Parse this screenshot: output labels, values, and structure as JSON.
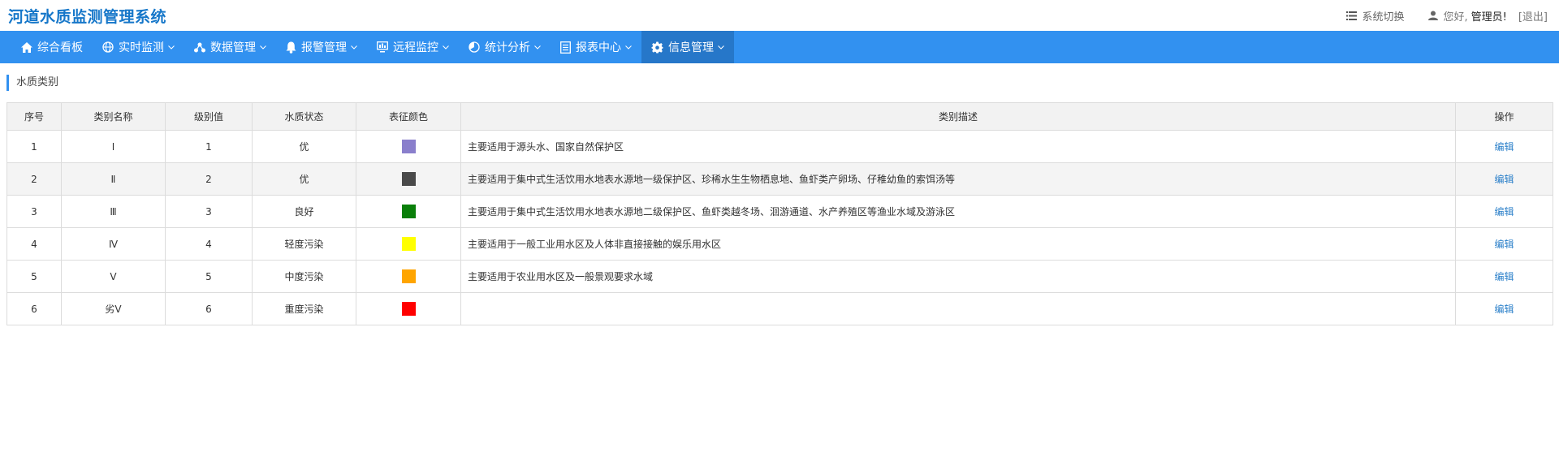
{
  "app": {
    "title": "河道水质监测管理系统"
  },
  "header": {
    "system_switch_label": "系统切换",
    "greeting": "您好,",
    "user": "管理员!",
    "logout_label": "[退出]"
  },
  "nav": {
    "items": [
      {
        "label": "综合看板",
        "icon": "home-icon",
        "dropdown": false
      },
      {
        "label": "实时监测",
        "icon": "globe-icon",
        "dropdown": true
      },
      {
        "label": "数据管理",
        "icon": "nodes-icon",
        "dropdown": true
      },
      {
        "label": "报警管理",
        "icon": "bell-icon",
        "dropdown": true
      },
      {
        "label": "远程监控",
        "icon": "monitor-icon",
        "dropdown": true
      },
      {
        "label": "统计分析",
        "icon": "pie-icon",
        "dropdown": true
      },
      {
        "label": "报表中心",
        "icon": "report-icon",
        "dropdown": true
      },
      {
        "label": "信息管理",
        "icon": "gear-icon",
        "dropdown": true,
        "active": true
      }
    ]
  },
  "section": {
    "title": "水质类别"
  },
  "table": {
    "headers": [
      "序号",
      "类别名称",
      "级别值",
      "水质状态",
      "表征颜色",
      "类别描述",
      "操作"
    ],
    "rows": [
      {
        "index": "1",
        "name": "Ⅰ",
        "level": "1",
        "status": "优",
        "color": "#8a7fcc",
        "desc": "主要适用于源头水、国家自然保护区",
        "action": "编辑"
      },
      {
        "index": "2",
        "name": "Ⅱ",
        "level": "2",
        "status": "优",
        "color": "#4a4a4a",
        "desc": "主要适用于集中式生活饮用水地表水源地一级保护区、珍稀水生生物栖息地、鱼虾类产卵场、仔稚幼鱼的索饵汤等",
        "action": "编辑"
      },
      {
        "index": "3",
        "name": "Ⅲ",
        "level": "3",
        "status": "良好",
        "color": "#0a7f0a",
        "desc": "主要适用于集中式生活饮用水地表水源地二级保护区、鱼虾类越冬场、洄游通道、水产养殖区等渔业水域及游泳区",
        "action": "编辑"
      },
      {
        "index": "4",
        "name": "Ⅳ",
        "level": "4",
        "status": "轻度污染",
        "color": "#ffff00",
        "desc": "主要适用于一般工业用水区及人体非直接接触的娱乐用水区",
        "action": "编辑"
      },
      {
        "index": "5",
        "name": "Ⅴ",
        "level": "5",
        "status": "中度污染",
        "color": "#ffa500",
        "desc": "主要适用于农业用水区及一般景观要求水域",
        "action": "编辑"
      },
      {
        "index": "6",
        "name": "劣Ⅴ",
        "level": "6",
        "status": "重度污染",
        "color": "#ff0000",
        "desc": "",
        "action": "编辑"
      }
    ]
  },
  "colors": {
    "accent": "#3291f0",
    "nav_active": "#2677c9",
    "title": "#1677c9",
    "link": "#2a7fc9"
  }
}
